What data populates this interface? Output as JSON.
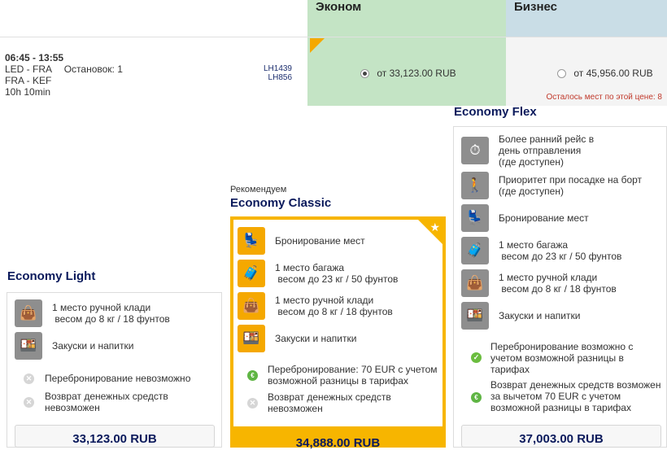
{
  "cabins": {
    "economy": "Эконом",
    "business": "Бизнес"
  },
  "flight": {
    "time": "06:45 - 13:55",
    "seg1": "LED - FRA",
    "stops": "Остановок: 1",
    "seg2": "FRA - KEF",
    "duration": "10h 10min",
    "flight_numbers": [
      "LH1439",
      "LH856"
    ]
  },
  "options": {
    "economy_price": "от 33,123.00 RUB",
    "business_price": "от 45,956.00 RUB",
    "seats_left": "Осталось мест по этой цене: 8"
  },
  "fares": {
    "light": {
      "title": "Economy Light",
      "features": [
        {
          "icon": "handbag-icon",
          "text": "1 место ручной клади\n весом до 8 кг / 18 фунтов"
        },
        {
          "icon": "meal-icon",
          "text": "Закуски и напитки"
        }
      ],
      "conditions": [
        {
          "icon": "cross-icon",
          "text": "Перебронирование невозможно"
        },
        {
          "icon": "cross-icon",
          "text": "Возврат денежных средств\nневозможен"
        }
      ],
      "price": "33,123.00 RUB"
    },
    "classic": {
      "recommended": "Рекомендуем",
      "title": "Economy Classic",
      "features": [
        {
          "icon": "seat-icon",
          "text": "Бронирование мест"
        },
        {
          "icon": "suitcase-icon",
          "text": "1 место багажа\n весом до 23 кг / 50 фунтов"
        },
        {
          "icon": "handbag-icon",
          "text": "1 место ручной клади\n весом до 8 кг / 18 фунтов"
        },
        {
          "icon": "meal-icon",
          "text": "Закуски и напитки"
        }
      ],
      "conditions": [
        {
          "icon": "euro-icon",
          "text": "Перебронирование: 70 EUR с учетом\nвозможной разницы в тарифах"
        },
        {
          "icon": "cross-icon",
          "text": "Возврат денежных средств\nневозможен"
        }
      ],
      "price": "34,888.00 RUB"
    },
    "flex": {
      "title": "Economy Flex",
      "features": [
        {
          "icon": "clock-icon",
          "text": "Более ранний рейс в\nдень отправления\n(где доступен)"
        },
        {
          "icon": "priority-boarding-icon",
          "text": "Приоритет при посадке на борт\n(где доступен)"
        },
        {
          "icon": "seat-icon",
          "text": "Бронирование мест"
        },
        {
          "icon": "suitcase-icon",
          "text": "1 место багажа\n весом до 23 кг / 50 фунтов"
        },
        {
          "icon": "handbag-icon",
          "text": "1 место ручной клади\n весом до 8 кг / 18 фунтов"
        },
        {
          "icon": "meal-icon",
          "text": "Закуски и напитки"
        }
      ],
      "conditions": [
        {
          "icon": "check-icon",
          "text": "Перебронирование возможно с\nучетом возможной разницы в\nтарифах"
        },
        {
          "icon": "euro-icon",
          "text": "Возврат денежных средств возможен\nза вычетом 70 EUR с учетом\nвозможной разницы в тарифах"
        }
      ],
      "price": "37,003.00 RUB"
    }
  },
  "colors": {
    "economy": "#c4e4c5",
    "business": "#c9dde6",
    "gold": "#f7b500",
    "navy": "#0b1a5c"
  }
}
